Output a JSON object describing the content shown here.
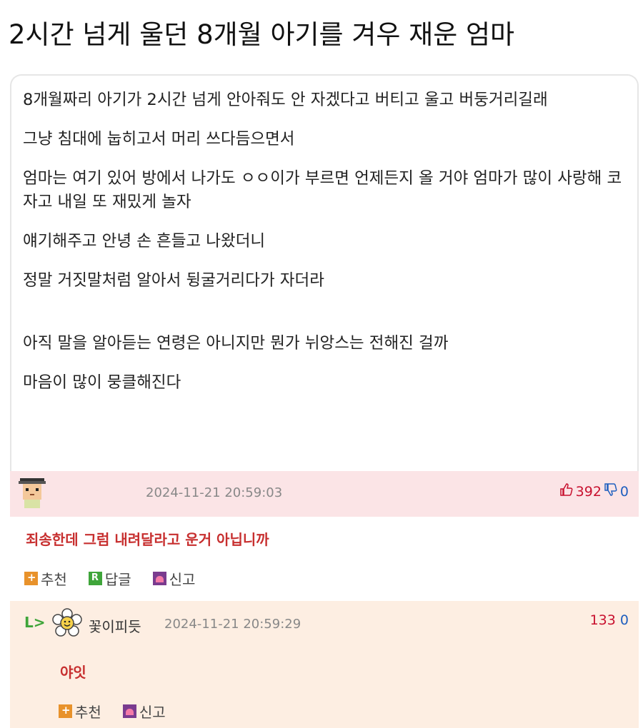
{
  "title": "2시간 넘게 울던 8개월 아기를 겨우 재운 엄마",
  "post": {
    "paragraphs": [
      "8개월짜리 아기가 2시간 넘게 안아줘도 안 자겠다고 버티고 울고 버둥거리길래",
      "그냥 침대에 눕히고서 머리 쓰다듬으면서",
      "엄마는 여기 있어 방에서 나가도 ㅇㅇ이가 부르면 언제든지 올 거야 엄마가 많이 사랑해 코 자고 내일 또 재밌게 놀자",
      "얘기해주고 안녕 손 흔들고 나왔더니",
      "정말 거짓말처럼 알아서 뒹굴거리다가 자더라",
      "아직 말을 알아듣는 연령은 아니지만 뭔가 뉘앙스는 전해진 걸까",
      "마음이 많이 뭉클해진다"
    ]
  },
  "comment": {
    "timestamp": "2024-11-21 20:59:03",
    "upvotes": "392",
    "downvotes": "0",
    "text": "죄송한데 그럼 내려달라고 운거 아닙니까",
    "actions": {
      "recommend": "추천",
      "reply": "답글",
      "report": "신고"
    }
  },
  "reply": {
    "arrow": "L>",
    "nickname": "꽃이피듯",
    "timestamp": "2024-11-21 20:59:29",
    "upvotes": "133",
    "downvotes": "0",
    "text": "야잇",
    "actions": {
      "recommend": "추천",
      "report": "신고"
    }
  },
  "icons": {
    "upvote": "thumbs-up-icon",
    "downvote": "thumbs-down-icon",
    "avatar1": "pixel-character-avatar",
    "avatar2": "flower-avatar"
  },
  "colors": {
    "comment_header_bg": "#fbe4e6",
    "reply_bg": "#fdeee2",
    "comment_text": "#c72f2f",
    "upvote": "#c8102e",
    "downvote": "#1f5fbf"
  }
}
